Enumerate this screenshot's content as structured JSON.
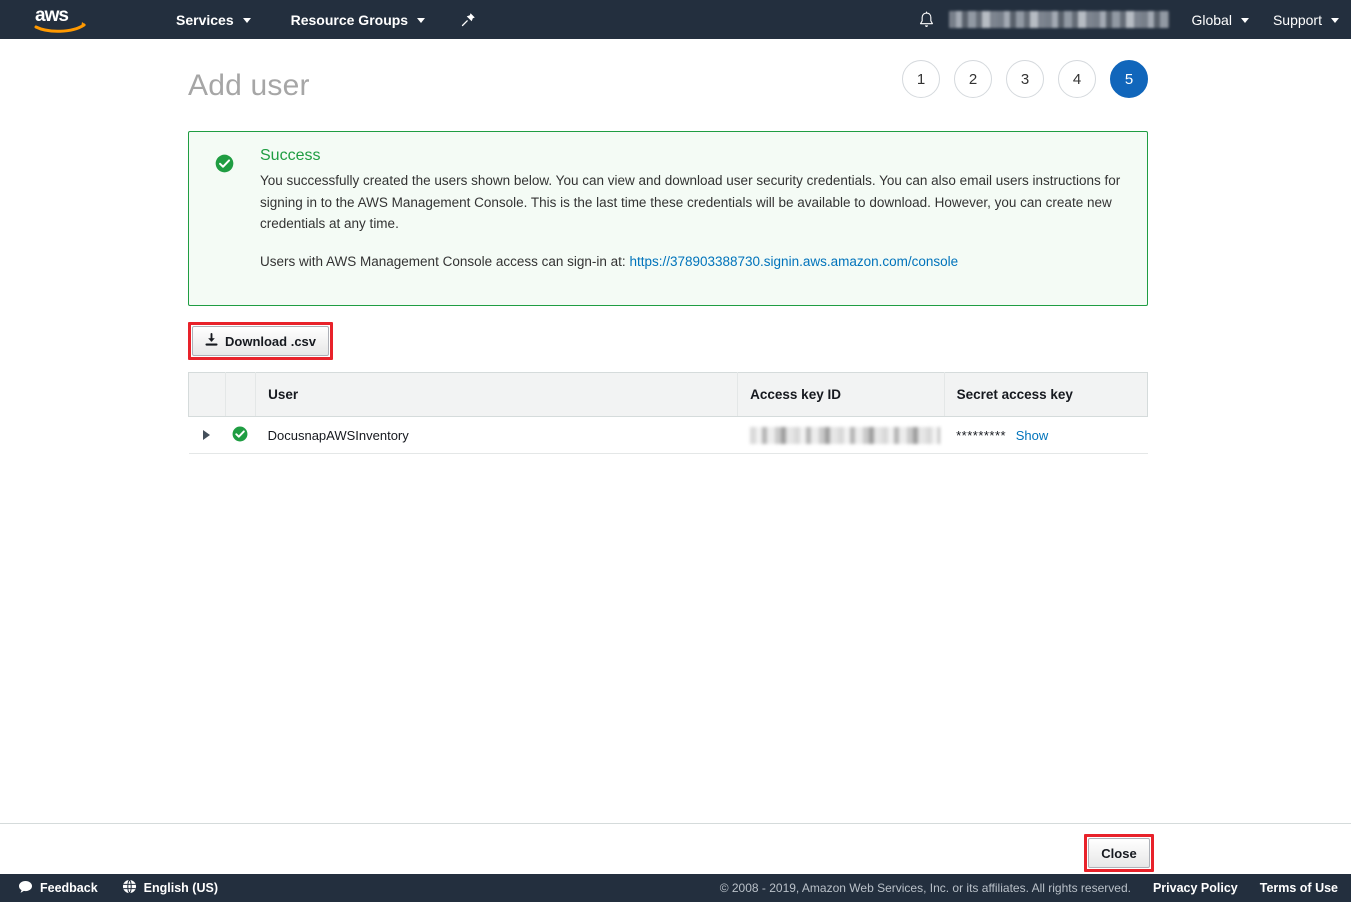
{
  "topnav": {
    "logo_alt": "aws",
    "services_label": "Services",
    "resource_groups_label": "Resource Groups",
    "pin_icon": "pin-icon",
    "bell_icon": "bell-icon",
    "account_label": "",
    "region_label": "Global",
    "support_label": "Support"
  },
  "page": {
    "title": "Add user",
    "steps": [
      {
        "number": "1",
        "active": false
      },
      {
        "number": "2",
        "active": false
      },
      {
        "number": "3",
        "active": false
      },
      {
        "number": "4",
        "active": false
      },
      {
        "number": "5",
        "active": true
      }
    ]
  },
  "alert": {
    "status_icon": "check-circle-icon",
    "title": "Success",
    "body": "You successfully created the users shown below. You can view and download user security credentials. You can also email users instructions for signing in to the AWS Management Console. This is the last time these credentials will be available to download. However, you can create new credentials at any time.",
    "signin_prefix": "Users with AWS Management Console access can sign-in at:",
    "signin_url": "https://378903388730.signin.aws.amazon.com/console",
    "border_color": "#1f9d42",
    "background_color": "#f4fbf5"
  },
  "toolbar": {
    "download_label": "Download .csv",
    "download_icon": "download-icon",
    "highlight_color": "#e8222a"
  },
  "table": {
    "headers": {
      "select": "",
      "status": "",
      "user": "User",
      "access_key_id": "Access key ID",
      "secret_access_key": "Secret access key"
    },
    "rows": [
      {
        "expander_icon": "chevron-right-icon",
        "status_icon": "check-circle-icon",
        "user": "DocusnapAWSInventory",
        "access_key_id": "",
        "secret_mask": "*********",
        "show_label": "Show"
      }
    ]
  },
  "actions": {
    "close_label": "Close"
  },
  "footer": {
    "feedback_label": "Feedback",
    "feedback_icon": "speech-bubble-icon",
    "language_label": "English (US)",
    "language_icon": "globe-icon",
    "copyright": "© 2008 - 2019, Amazon Web Services, Inc. or its affiliates. All rights reserved.",
    "privacy_label": "Privacy Policy",
    "terms_label": "Terms of Use"
  }
}
